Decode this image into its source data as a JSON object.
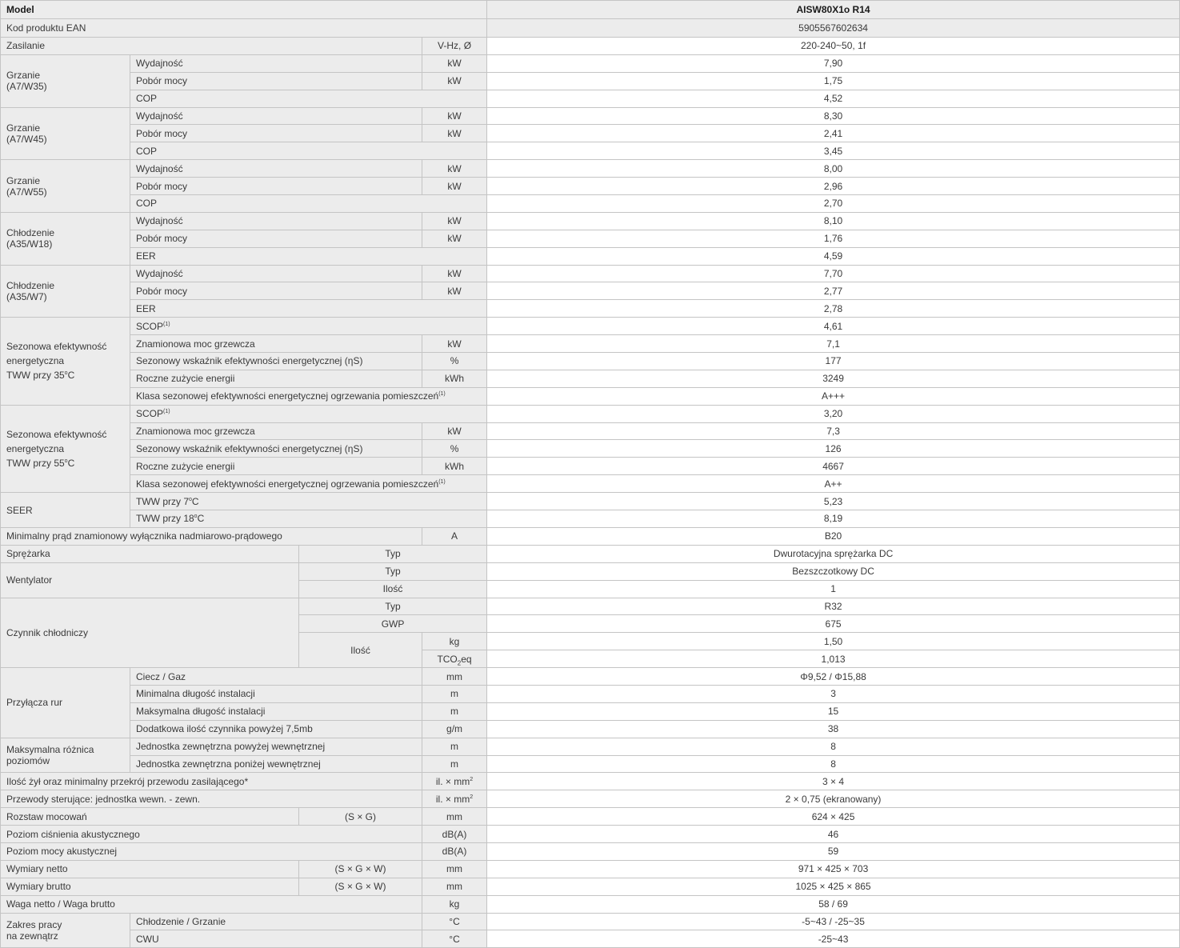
{
  "header": {
    "model_label": "Model",
    "model_value": "AISW80X1o R14"
  },
  "ean": {
    "label": "Kod produktu EAN",
    "value": "5905567602634"
  },
  "power_supply": {
    "label": "Zasilanie",
    "unit": "V-Hz, Ø",
    "value": "220-240~50, 1f"
  },
  "heating_blocks": [
    {
      "title1": "Grzanie",
      "title2": "(A7/W35)",
      "rows": [
        {
          "label": "Wydajność",
          "unit": "kW",
          "value": "7,90"
        },
        {
          "label": "Pobór mocy",
          "unit": "kW",
          "value": "1,75"
        },
        {
          "label": "COP",
          "value": "4,52"
        }
      ]
    },
    {
      "title1": "Grzanie",
      "title2": "(A7/W45)",
      "rows": [
        {
          "label": "Wydajność",
          "unit": "kW",
          "value": "8,30"
        },
        {
          "label": "Pobór mocy",
          "unit": "kW",
          "value": "2,41"
        },
        {
          "label": "COP",
          "value": "3,45"
        }
      ]
    },
    {
      "title1": "Grzanie",
      "title2": "(A7/W55)",
      "rows": [
        {
          "label": "Wydajność",
          "unit": "kW",
          "value": "8,00"
        },
        {
          "label": "Pobór mocy",
          "unit": "kW",
          "value": "2,96"
        },
        {
          "label": "COP",
          "value": "2,70"
        }
      ]
    },
    {
      "title1": "Chłodzenie",
      "title2": "(A35/W18)",
      "rows": [
        {
          "label": "Wydajność",
          "unit": "kW",
          "value": "8,10"
        },
        {
          "label": "Pobór mocy",
          "unit": "kW",
          "value": "1,76"
        },
        {
          "label": "EER",
          "value": "4,59"
        }
      ]
    },
    {
      "title1": "Chłodzenie",
      "title2": "(A35/W7)",
      "rows": [
        {
          "label": "Wydajność",
          "unit": "kW",
          "value": "7,70"
        },
        {
          "label": "Pobór mocy",
          "unit": "kW",
          "value": "2,77"
        },
        {
          "label": "EER",
          "value": "2,78"
        }
      ]
    }
  ],
  "seasonal_blocks": [
    {
      "title1": "Sezonowa efektywność",
      "title2": "energetyczna",
      "title3": "TWW przy 35",
      "title_sup": "o",
      "title_suffix": "C",
      "rows": [
        {
          "label": "SCOP",
          "sup": "(1)",
          "value": "4,61"
        },
        {
          "label": "Znamionowa moc grzewcza",
          "unit": "kW",
          "value": "7,1"
        },
        {
          "label": "Sezonowy wskaźnik efektywności energetycznej (ηS)",
          "unit": "%",
          "value": "177"
        },
        {
          "label": "Roczne zużycie energii",
          "unit": "kWh",
          "value": "3249"
        },
        {
          "label": "Klasa sezonowej efektywności energetycznej ogrzewania pomieszczeń",
          "sup": "(1)",
          "value": "A+++"
        }
      ]
    },
    {
      "title1": "Sezonowa efektywność",
      "title2": "energetyczna",
      "title3": "TWW przy 55",
      "title_sup": "o",
      "title_suffix": "C",
      "rows": [
        {
          "label": "SCOP",
          "sup": "(1)",
          "value": "3,20"
        },
        {
          "label": "Znamionowa moc grzewcza",
          "unit": "kW",
          "value": "7,3"
        },
        {
          "label": "Sezonowy wskaźnik efektywności energetycznej (ηS)",
          "unit": "%",
          "value": "126"
        },
        {
          "label": "Roczne zużycie energii",
          "unit": "kWh",
          "value": "4667"
        },
        {
          "label": "Klasa sezonowej efektywności energetycznej ogrzewania pomieszczeń",
          "sup": "(1)",
          "value": "A++"
        }
      ]
    }
  ],
  "seer": {
    "label": "SEER",
    "rows": [
      {
        "label": "TWW przy 7",
        "sup": "o",
        "suffix": "C",
        "value": "5,23"
      },
      {
        "label": "TWW przy 18",
        "sup": "o",
        "suffix": "C",
        "value": "8,19"
      }
    ]
  },
  "breaker": {
    "label": "Minimalny prąd znamionowy wyłącznika nadmiarowo-prądowego",
    "unit": "A",
    "value": "B20"
  },
  "compressor": {
    "label": "Sprężarka",
    "sub": "Typ",
    "value": "Dwurotacyjna sprężarka DC"
  },
  "fan": {
    "label": "Wentylator",
    "rows": [
      {
        "sub": "Typ",
        "value": "Bezszczotkowy DC"
      },
      {
        "sub": "Ilość",
        "value": "1"
      }
    ]
  },
  "refrigerant": {
    "label": "Czynnik chłodniczy",
    "type_label": "Typ",
    "type_value": "R32",
    "gwp_label": "GWP",
    "gwp_value": "675",
    "qty_label": "Ilość",
    "kg_unit": "kg",
    "kg_value": "1,50",
    "tco_unit_pre": "TCO",
    "tco_unit_sub": "2",
    "tco_unit_post": "eq",
    "tco_value": "1,013"
  },
  "pipes": {
    "label": "Przyłącza rur",
    "rows": [
      {
        "label": "Ciecz / Gaz",
        "unit": "mm",
        "value": "Φ9,52 / Φ15,88"
      },
      {
        "label": "Minimalna długość instalacji",
        "unit": "m",
        "value": "3"
      },
      {
        "label": "Maksymalna długość instalacji",
        "unit": "m",
        "value": "15"
      },
      {
        "label": "Dodatkowa ilość czynnika powyżej 7,5mb",
        "unit": "g/m",
        "value": "38"
      }
    ]
  },
  "level_diff": {
    "label1": "Maksymalna różnica",
    "label2": "poziomów",
    "rows": [
      {
        "label": "Jednostka zewnętrzna powyżej wewnętrznej",
        "unit": "m",
        "value": "8"
      },
      {
        "label": "Jednostka zewnętrzna poniżej wewnętrznej",
        "unit": "m",
        "value": "8"
      }
    ]
  },
  "power_cable": {
    "label": "Ilość żył oraz minimalny przekrój przewodu zasilającego*",
    "unit": "il. × mm",
    "unit_sup": "2",
    "value": "3 × 4"
  },
  "control_cable": {
    "label": "Przewody sterujące: jednostka wewn. - zewn.",
    "unit": "il. × mm",
    "unit_sup": "2",
    "value": "2 × 0,75 (ekranowany)"
  },
  "mount": {
    "label": "Rozstaw mocowań",
    "sub": "(S × G)",
    "unit": "mm",
    "value": "624 × 425"
  },
  "sound_pressure": {
    "label": "Poziom ciśnienia akustycznego",
    "unit": "dB(A)",
    "value": "46"
  },
  "sound_power": {
    "label": "Poziom mocy akustycznej",
    "unit": "dB(A)",
    "value": "59"
  },
  "dims_net": {
    "label": "Wymiary netto",
    "sub": "(S × G × W)",
    "unit": "mm",
    "value": "971 × 425 × 703"
  },
  "dims_gross": {
    "label": "Wymiary brutto",
    "sub": "(S × G × W)",
    "unit": "mm",
    "value": "1025 × 425 × 865"
  },
  "weight": {
    "label": "Waga netto / Waga brutto",
    "unit": "kg",
    "value": "58 / 69"
  },
  "range": {
    "label1": "Zakres pracy",
    "label2": "na zewnątrz",
    "rows": [
      {
        "label": "Chłodzenie / Grzanie",
        "unit": "°C",
        "value": "-5~43 / -25~35"
      },
      {
        "label": "CWU",
        "unit": "°C",
        "value": "-25~43"
      }
    ]
  }
}
